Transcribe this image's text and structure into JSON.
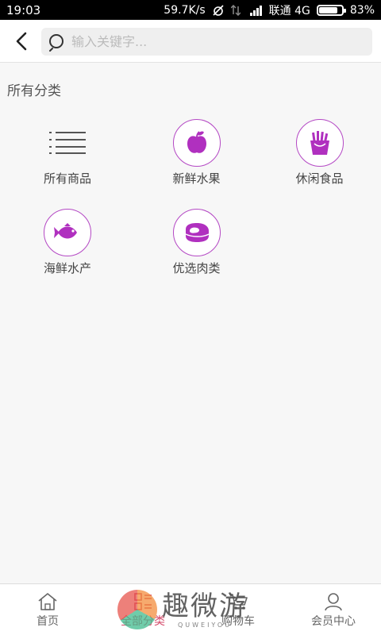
{
  "status_bar": {
    "time": "19:03",
    "speed": "59.7K/s",
    "carrier": "联通 4G",
    "battery": "83%",
    "battery_level": 0.83
  },
  "header": {
    "back_icon": "chevron-left-icon",
    "search": {
      "placeholder": "输入关键字...",
      "value": ""
    }
  },
  "section": {
    "title": "所有分类"
  },
  "categories": [
    {
      "label": "所有商品",
      "icon": "list-icon"
    },
    {
      "label": "新鲜水果",
      "icon": "apple-icon"
    },
    {
      "label": "休闲食品",
      "icon": "fries-icon"
    },
    {
      "label": "海鲜水产",
      "icon": "fish-icon"
    },
    {
      "label": "优选肉类",
      "icon": "meat-icon"
    }
  ],
  "bottom_nav": [
    {
      "label": "首页",
      "icon": "home-icon"
    },
    {
      "label": "全部分类",
      "icon": "category-icon",
      "active": true
    },
    {
      "label": "购物车",
      "icon": "cart-icon"
    },
    {
      "label": "会员中心",
      "icon": "user-icon"
    }
  ],
  "watermark": {
    "text": "趣微游",
    "sub": "QUWEIYOU"
  },
  "colors": {
    "accent": "#b030bf",
    "active_nav": "#d44a6a"
  }
}
